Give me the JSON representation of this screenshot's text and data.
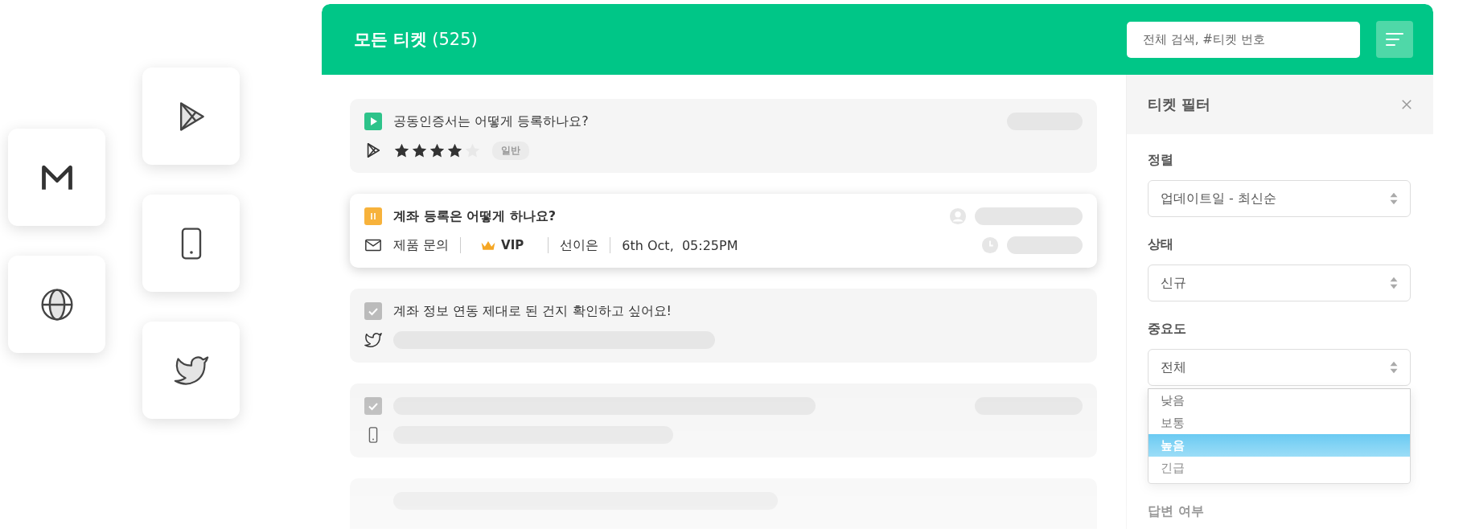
{
  "channel_columns": [
    [
      {
        "kind": "mail-m"
      },
      {
        "kind": "globe"
      }
    ],
    [
      {
        "kind": "play"
      },
      {
        "kind": "mobile"
      },
      {
        "kind": "twitter"
      }
    ]
  ],
  "header": {
    "title": "모든 티켓",
    "count": "(525)",
    "search": {
      "placeholder": "전체 검색, #티켓 번호"
    }
  },
  "tickets": [
    {
      "selected": false,
      "status": {
        "kind": "play"
      },
      "channel": {
        "kind": "play"
      },
      "title": "공동인증서는 어떻게 등록하나요?",
      "stars": 4,
      "tag": "일반"
    },
    {
      "selected": true,
      "status": {
        "kind": "pause"
      },
      "channel": {
        "kind": "mail"
      },
      "title": "계좌 등록은 어떻게 하나요?",
      "category": "제품 문의",
      "vip": "VIP",
      "assignee": "선이은",
      "date": "6th Oct,  05:25PM"
    },
    {
      "selected": false,
      "status": {
        "kind": "check"
      },
      "channel": {
        "kind": "twitter"
      },
      "title": "계좌 정보 연동 제대로 된 건지 확인하고 싶어요!"
    },
    {
      "selected": false,
      "status": {
        "kind": "check"
      },
      "channel": {
        "kind": "mobile"
      }
    },
    {
      "selected": false
    }
  ],
  "filter": {
    "title": "티켓 필터",
    "groups": [
      {
        "label": "정렬",
        "value": "업데이트일 - 최신순"
      },
      {
        "label": "상태",
        "value": "신규"
      },
      {
        "label": "중요도",
        "value": "전체",
        "options": [
          {
            "label": "낮음",
            "selected": false
          },
          {
            "label": "보통",
            "selected": false
          },
          {
            "label": "높음",
            "selected": true
          },
          {
            "label": "긴급",
            "selected": false
          }
        ]
      }
    ],
    "next_label": "답변 여부"
  }
}
